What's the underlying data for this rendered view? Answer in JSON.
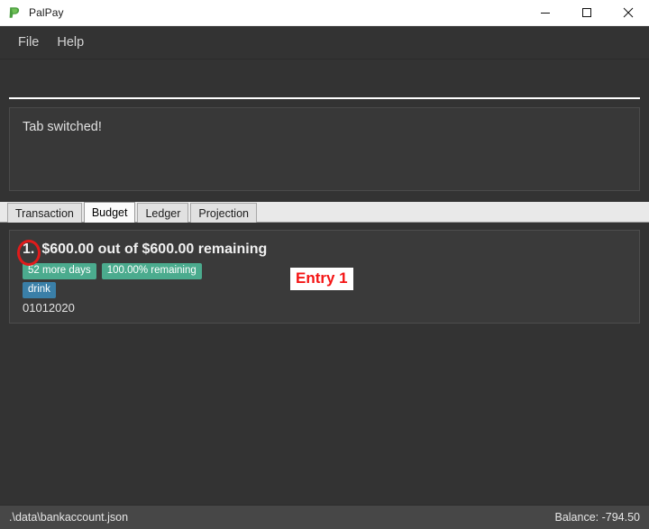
{
  "window": {
    "title": "PalPay",
    "app_icon": "palpay-leaf-icon",
    "controls": {
      "minimize": "minimize-icon",
      "maximize": "maximize-icon",
      "close": "close-icon"
    }
  },
  "menubar": {
    "items": [
      {
        "label": "File"
      },
      {
        "label": "Help"
      }
    ]
  },
  "command_input": {
    "value": "",
    "placeholder": ""
  },
  "message_box": {
    "text": "Tab switched!"
  },
  "tabs": {
    "active": "Budget",
    "items": [
      {
        "label": "Transaction",
        "active": false
      },
      {
        "label": "Budget",
        "active": true
      },
      {
        "label": "Ledger",
        "active": false
      },
      {
        "label": "Projection",
        "active": false
      }
    ]
  },
  "entries": [
    {
      "number": "1.",
      "title": "$600.00 out of $600.00 remaining",
      "badges": [
        {
          "text": "52 more days",
          "color": "#4bab8e",
          "style": "green"
        },
        {
          "text": "100.00% remaining",
          "color": "#4bab8e",
          "style": "green"
        },
        {
          "text": "drink",
          "color": "#3a7fa8",
          "style": "blue"
        }
      ],
      "date": "01012020"
    }
  ],
  "annotations": {
    "circle_target": "entry-number-1",
    "label": "Entry 1",
    "label_color": "#f41414",
    "circle_color": "#e01b1b"
  },
  "statusbar": {
    "file_path": ".\\data\\bankaccount.json",
    "balance": "Balance: -794.50"
  }
}
